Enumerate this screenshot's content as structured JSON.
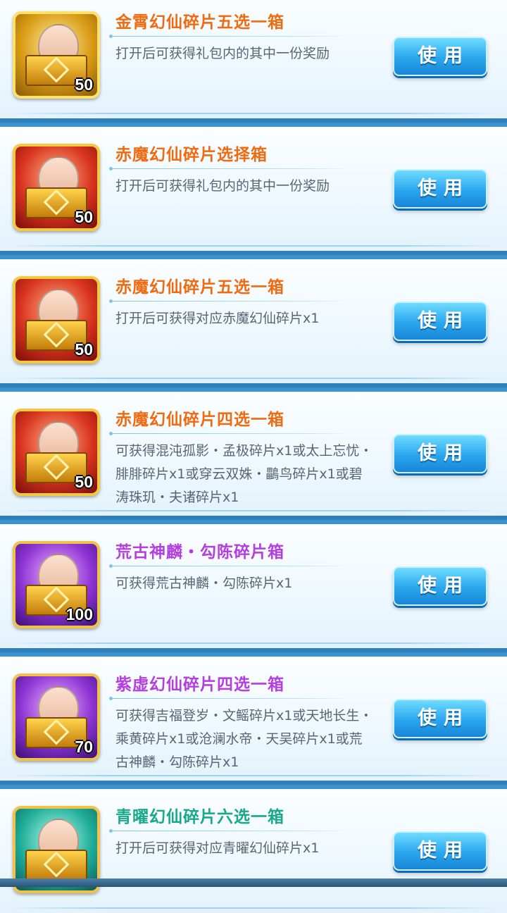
{
  "items": [
    {
      "title": "金霄幻仙碎片五选一箱",
      "title_color": "orange",
      "description": "打开后可获得礼包内的其中一份奖励",
      "count": "50",
      "icon_theme": "gold",
      "icon_name": "treasure-chest-icon",
      "button_label": "使用"
    },
    {
      "title": "赤魔幻仙碎片选择箱",
      "title_color": "orange",
      "description": "打开后可获得礼包内的其中一份奖励",
      "count": "50",
      "icon_theme": "red",
      "icon_name": "treasure-chest-icon",
      "button_label": "使用"
    },
    {
      "title": "赤魔幻仙碎片五选一箱",
      "title_color": "orange",
      "description": "打开后可获得对应赤魔幻仙碎片x1",
      "count": "50",
      "icon_theme": "red",
      "icon_name": "treasure-chest-icon",
      "button_label": "使用"
    },
    {
      "title": "赤魔幻仙碎片四选一箱",
      "title_color": "orange",
      "description": "可获得混沌孤影・孟极碎片x1或太上忘忧・\n腓腓碎片x1或穿云双姝・鸓鸟碎片x1或碧\n涛珠玑・夫诸碎片x1",
      "count": "50",
      "icon_theme": "red",
      "icon_name": "treasure-chest-icon",
      "button_label": "使用"
    },
    {
      "title": "荒古神麟・勾陈碎片箱",
      "title_color": "purple",
      "description": "可获得荒古神麟・勾陈碎片x1",
      "count": "100",
      "icon_theme": "purple",
      "icon_name": "treasure-chest-icon",
      "button_label": "使用"
    },
    {
      "title": "紫虚幻仙碎片四选一箱",
      "title_color": "purple",
      "description": "可获得吉福登岁・文鳐碎片x1或天地长生・\n乘黄碎片x1或沧澜水帝・天吴碎片x1或荒\n古神麟・勾陈碎片x1",
      "count": "70",
      "icon_theme": "purple",
      "icon_name": "treasure-chest-icon",
      "button_label": "使用"
    },
    {
      "title": "青曜幻仙碎片六选一箱",
      "title_color": "green",
      "description": "打开后可获得对应青曜幻仙碎片x1",
      "count": "",
      "icon_theme": "cyan",
      "icon_name": "treasure-chest-icon",
      "button_label": "使用"
    }
  ],
  "colors": {
    "orange_title": "#f06a10",
    "purple_title": "#b43ee0",
    "green_title": "#18a88a",
    "button": "#2aa6ee",
    "card_border": "#3a92cf"
  }
}
